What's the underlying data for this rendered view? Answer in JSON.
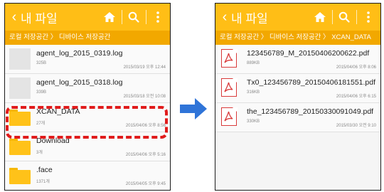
{
  "left_screen": {
    "title": "내 파일",
    "breadcrumb": "로컬 저장공간 〉 디바이스 저장공간",
    "files": [
      {
        "name": "agent_log_2015_0319.log",
        "size": "325B",
        "date": "2015/03/19 오후 12:44",
        "icon": "document-thumbnail-icon"
      },
      {
        "name": "agent_log_2015_0318.log",
        "size": "339B",
        "date": "2015/03/18 오전 10:08",
        "icon": "document-thumbnail-icon"
      },
      {
        "name": "XCAN_DATA",
        "size": "27개",
        "date": "2015/04/06 오후 8:56",
        "icon": "folder-icon"
      },
      {
        "name": "Download",
        "size": "3개",
        "date": "2015/04/06 오후 5:16",
        "icon": "folder-icon"
      },
      {
        "name": ".face",
        "size": "1371개",
        "date": "2015/04/05 오후 9:45",
        "icon": "folder-icon"
      }
    ]
  },
  "right_screen": {
    "title": "내 파일",
    "breadcrumb": "로컬 저장공간 〉 디바이스 저장공간 〉 XCAN_DATA",
    "files": [
      {
        "name": "123456789_M_20150406200622.pdf",
        "size": "889KB",
        "date": "2015/04/06 오후 8:06",
        "icon": "pdf-icon"
      },
      {
        "name": "Tx0_123456789_20150406181551.pdf",
        "size": "316KB",
        "date": "2015/04/06 오후 6:15",
        "icon": "pdf-icon"
      },
      {
        "name": "the_123456789_20150330091049.pdf",
        "size": "330KB",
        "date": "2015/03/30 오전 9:10",
        "icon": "pdf-icon"
      }
    ]
  },
  "colors": {
    "appbar": "#ffbe16",
    "breadcrumb_bar": "#f2a800",
    "highlight": "#e01b1b",
    "arrow": "#2f74d8",
    "pdf_icon": "#d93a3a"
  },
  "icons": [
    "back-icon",
    "home-icon",
    "search-icon",
    "more-options-icon",
    "right-arrow-icon"
  ]
}
